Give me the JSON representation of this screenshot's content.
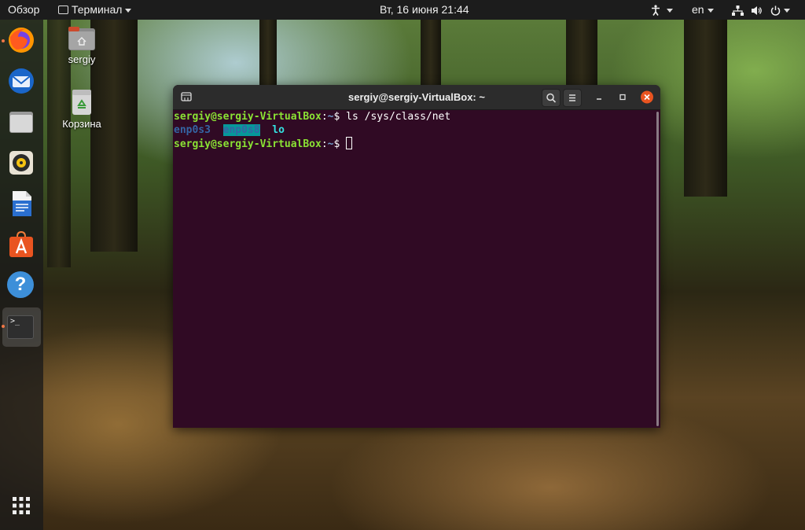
{
  "topbar": {
    "activities": "Обзор",
    "app_menu": "Терминал",
    "clock": "Вт, 16 июня  21:44",
    "language": "en"
  },
  "desktop": {
    "home_label": "sergiy",
    "trash_label": "Корзина"
  },
  "dock": {
    "apps": [
      "firefox-icon",
      "thunderbird-icon",
      "files-icon",
      "rhythmbox-icon",
      "writer-icon",
      "software-icon",
      "help-icon",
      "terminal-icon"
    ],
    "help_glyph": "?",
    "terminal_glyph": ">_"
  },
  "terminal": {
    "title": "sergiy@sergiy-VirtualBox: ~",
    "prompt_user": "sergiy@sergiy-VirtualBox",
    "prompt_sep": ":",
    "prompt_path": "~",
    "prompt_dollar": "$ ",
    "command": "ls /sys/class/net",
    "output": [
      "enp0s3",
      "enp0s8",
      "lo"
    ]
  },
  "colors": {
    "terminal_bg": "#300a24",
    "prompt_green": "#8ae234",
    "prompt_blue": "#729fcf",
    "close_orange": "#e95420"
  }
}
